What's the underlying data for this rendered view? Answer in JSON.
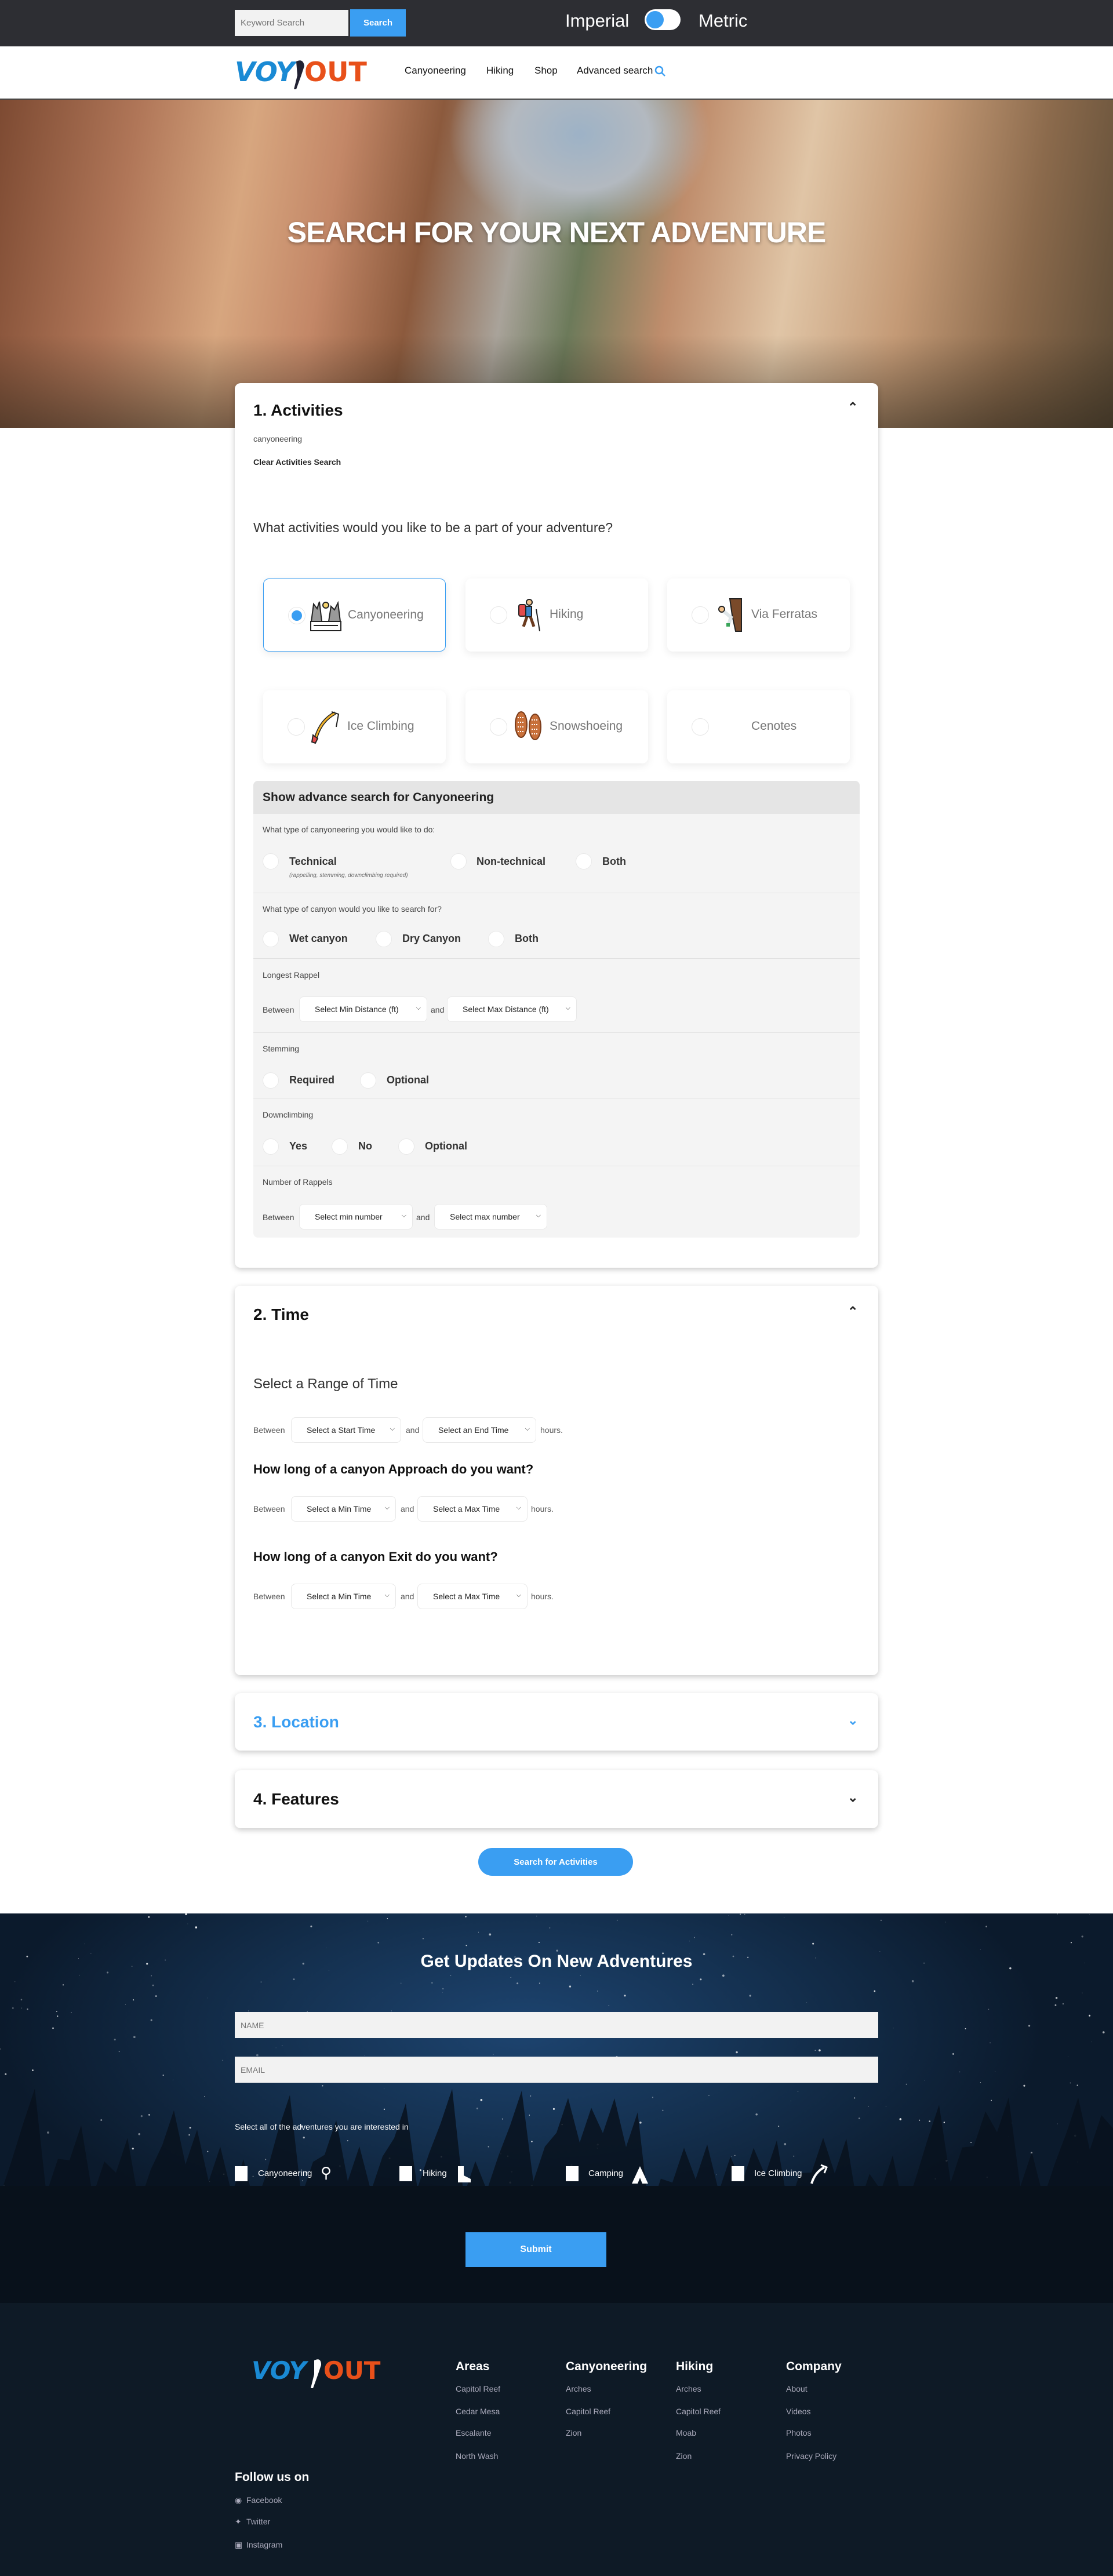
{
  "topbar": {
    "keyword_placeholder": "Keyword Search",
    "search_label": "Search",
    "unit_left": "Imperial",
    "unit_right": "Metric",
    "unit_selected": "Imperial"
  },
  "nav": {
    "logo": "VOYOUT",
    "links": [
      "Canyoneering",
      "Hiking",
      "Shop",
      "Advanced search"
    ]
  },
  "hero": {
    "title": "SEARCH FOR YOUR NEXT ADVENTURE"
  },
  "activities": {
    "title": "1. Activities",
    "selected_text": "canyoneering",
    "clear_label": "Clear Activities Search",
    "question": "What activities would you like to be a part of your adventure?",
    "options": [
      {
        "label": "Canyoneering",
        "icon": "canyon-icon",
        "selected": true
      },
      {
        "label": "Hiking",
        "icon": "hiker-icon",
        "selected": false
      },
      {
        "label": "Via Ferratas",
        "icon": "climber-icon",
        "selected": false
      },
      {
        "label": "Ice Climbing",
        "icon": "ice-axe-icon",
        "selected": false
      },
      {
        "label": "Snowshoeing",
        "icon": "snowshoe-icon",
        "selected": false
      },
      {
        "label": "Cenotes",
        "icon": "",
        "selected": false
      }
    ],
    "advanced": {
      "header": "Show advance search for Canyoneering",
      "type_q": "What type of canyoneering you would like to do:",
      "type_opts": [
        "Technical",
        "Non-technical",
        "Both"
      ],
      "type_note": "(rappelling, stemming, downclimbing required)",
      "canyon_q": "What type of canyon would you like to search for?",
      "canyon_opts": [
        "Wet canyon",
        "Dry Canyon",
        "Both"
      ],
      "rappel_q": "Longest Rappel",
      "between": "Between",
      "and": "and",
      "rappel_min": "Select Min Distance (ft)",
      "rappel_max": "Select Max Distance (ft)",
      "stem_q": "Stemming",
      "stem_opts": [
        "Required",
        "Optional"
      ],
      "down_q": "Downclimbing",
      "down_opts": [
        "Yes",
        "No",
        "Optional"
      ],
      "num_q": "Number of Rappels",
      "num_min": "Select min number",
      "num_max": "Select max number"
    }
  },
  "time": {
    "title": "2. Time",
    "range_heading": "Select a Range of Time",
    "between": "Between",
    "and": "and",
    "hours": "hours.",
    "start": "Select a Start Time",
    "end": "Select an End Time",
    "approach_heading": "How long of a canyon Approach do you want?",
    "exit_heading": "How long of a canyon Exit do you want?",
    "min": "Select a Min Time",
    "max": "Select a Max Time"
  },
  "location": {
    "title": "3. Location"
  },
  "features": {
    "title": "4. Features"
  },
  "search_button": "Search for Activities",
  "newsletter": {
    "title": "Get Updates On New Adventures",
    "name_placeholder": "NAME",
    "email_placeholder": "EMAIL",
    "prompt": "Select all of the adventures you are interested in",
    "options": [
      "Canyoneering",
      "Hiking",
      "Camping",
      "Ice Climbing"
    ],
    "submit": "Submit"
  },
  "footer": {
    "columns": [
      {
        "title": "Areas",
        "items": [
          "Capitol Reef",
          "Cedar Mesa",
          "Escalante",
          "North Wash"
        ]
      },
      {
        "title": "Canyoneering",
        "items": [
          "Arches",
          "Capitol Reef",
          "Zion"
        ]
      },
      {
        "title": "Hiking",
        "items": [
          "Arches",
          "Capitol Reef",
          "Moab",
          "Zion"
        ]
      },
      {
        "title": "Company",
        "items": [
          "About",
          "Videos",
          "Photos",
          "Privacy Policy"
        ]
      }
    ],
    "follow": "Follow us on",
    "social": [
      "Facebook",
      "Twitter",
      "Instagram"
    ]
  },
  "colors": {
    "accent": "#3a9ef2",
    "topbar": "#2d2e33",
    "footer": "#0e1a26",
    "logo_blue": "#1a8ad4",
    "logo_orange": "#e8501a"
  }
}
